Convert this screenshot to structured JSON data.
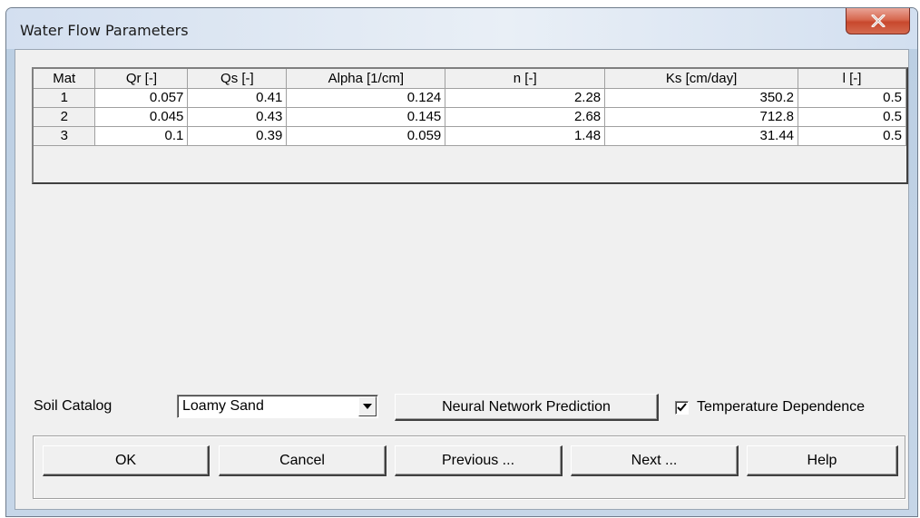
{
  "window": {
    "title": "Water Flow Parameters",
    "close_icon": "close-x-icon"
  },
  "table": {
    "headers": [
      "Mat",
      "Qr [-]",
      "Qs [-]",
      "Alpha [1/cm]",
      "n [-]",
      "Ks [cm/day]",
      "l [-]"
    ],
    "rows": [
      [
        "1",
        "0.057",
        "0.41",
        "0.124",
        "2.28",
        "350.2",
        "0.5"
      ],
      [
        "2",
        "0.045",
        "0.43",
        "0.145",
        "2.68",
        "712.8",
        "0.5"
      ],
      [
        "3",
        "0.1",
        "0.39",
        "0.059",
        "1.48",
        "31.44",
        "0.5"
      ]
    ]
  },
  "soil_catalog": {
    "label": "Soil Catalog",
    "selected": "Loamy Sand",
    "dropdown_icon": "chevron-down-icon"
  },
  "neural_button": "Neural Network Prediction",
  "temperature": {
    "label": "Temperature Dependence",
    "checked": true
  },
  "buttons": {
    "ok": "OK",
    "cancel": "Cancel",
    "previous": "Previous ...",
    "next": "Next ...",
    "help": "Help"
  },
  "colors": {
    "close_button": "#c8482d",
    "dialog_face": "#f0f0f0",
    "frame": "#c6d6e8"
  }
}
